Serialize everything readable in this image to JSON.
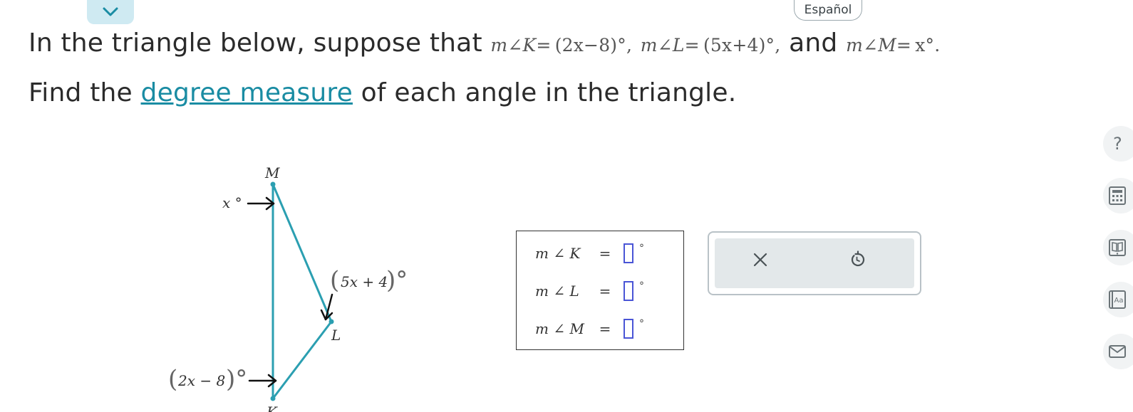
{
  "header": {
    "collapse_icon": "chevron-down-icon",
    "language_button": "Español"
  },
  "question": {
    "line1_intro": "In the triangle below, suppose that",
    "angle_k": {
      "prefix": "m∠K",
      "expr": "= (2x−8)°,"
    },
    "angle_l": {
      "prefix": "m∠L",
      "expr": "= (5x+4)°,"
    },
    "conj": "and",
    "angle_m": {
      "prefix": "m∠M",
      "expr": "= x°."
    },
    "line2_before": "Find the",
    "line2_link": "degree measure",
    "line2_after": "of each angle in the triangle."
  },
  "figure": {
    "vertex_m": "M",
    "vertex_l": "L",
    "vertex_k": "K",
    "label_m": "x °",
    "label_l_open": "(",
    "label_l": "5x + 4",
    "label_l_close": ")°",
    "label_k_open": "(",
    "label_k": "2x − 8",
    "label_k_close": ")°",
    "line_color": "#2b9fb1"
  },
  "answer": {
    "rows": [
      {
        "label": "m ∠ K",
        "eq": "=",
        "value": "",
        "unit": "°"
      },
      {
        "label": "m ∠ L",
        "eq": "=",
        "value": "",
        "unit": "°"
      },
      {
        "label": "m ∠ M",
        "eq": "=",
        "value": "",
        "unit": "°"
      }
    ]
  },
  "buttons": {
    "clear_icon": "close-icon",
    "undo_icon": "undo-icon"
  },
  "side_tools": [
    "help-icon",
    "calculator-icon",
    "ebook-icon",
    "dictionary-icon",
    "message-icon"
  ],
  "colors": {
    "accent": "#1a8ca3",
    "input_border": "#4a55d6",
    "triangle": "#2b9fb1"
  }
}
